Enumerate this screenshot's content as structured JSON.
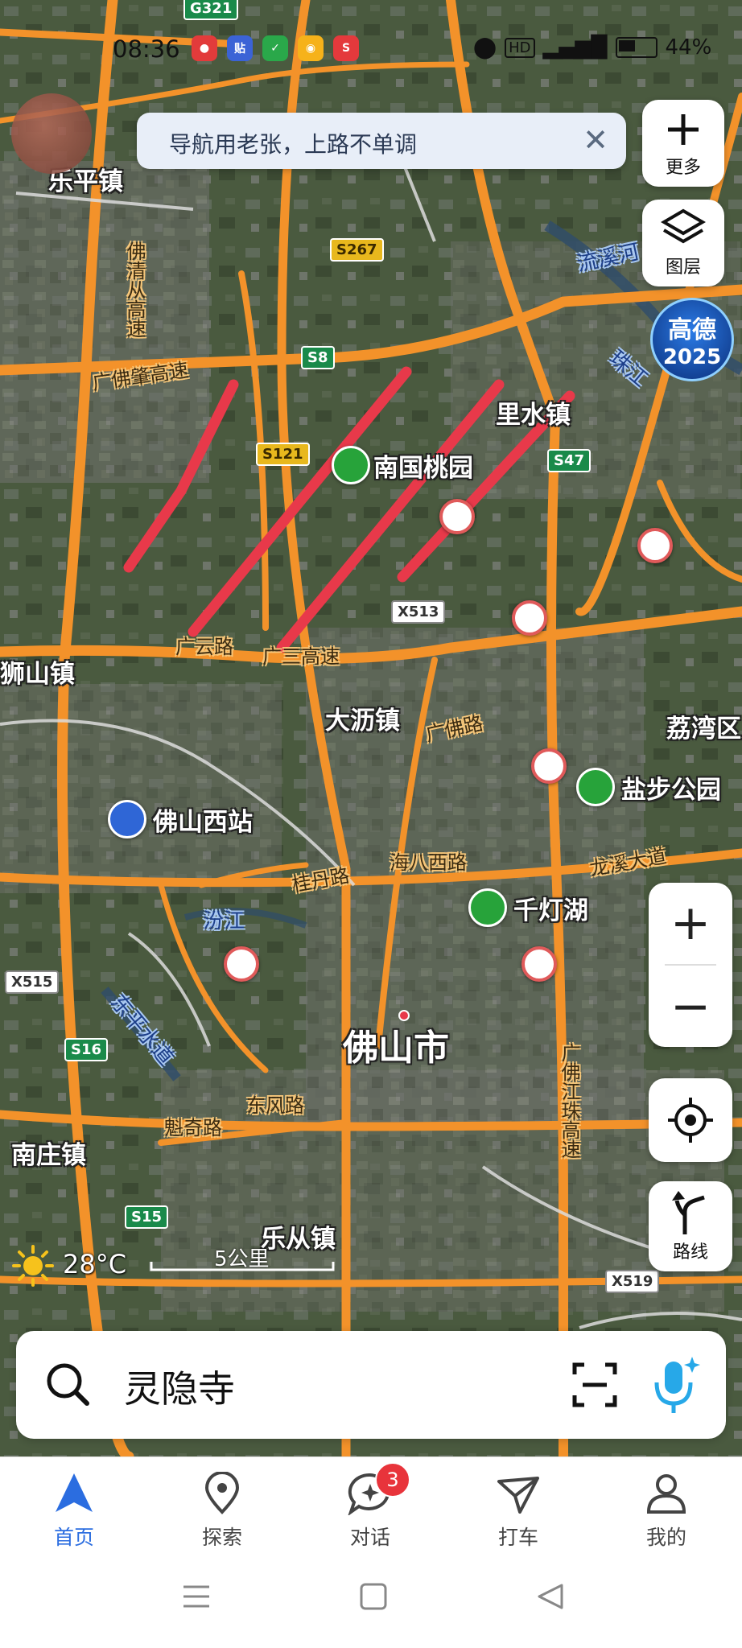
{
  "status_bar": {
    "time": "08:36",
    "battery": "44%",
    "app_icons": [
      "red-app",
      "tieba-app",
      "green-app",
      "weibo-app",
      "sina-app"
    ]
  },
  "banner": {
    "text": "导航用老张，上路不单调"
  },
  "side_buttons": {
    "more_label": "更多",
    "layers_label": "图层",
    "brand_badge_top": "高德",
    "brand_badge_year": "2025",
    "route_label": "路线"
  },
  "map": {
    "place_labels": {
      "leping": "乐平镇",
      "nanguo": "南国桃园",
      "lishui": "里水镇",
      "shishan": "狮山镇",
      "dali": "大沥镇",
      "lichwan": "荔湾区",
      "foshan_west": "佛山西站",
      "yanbu": "盐步公园",
      "qiandeng": "千灯湖",
      "foshan_city": "佛山市",
      "nanzhuang": "南庄镇",
      "lecong": "乐从镇"
    },
    "road_labels": {
      "fozhao": "广佛肇高速",
      "guangyun": "广云路",
      "guang_gaosu": "广三高速",
      "fofo_rd": "广佛路",
      "haiba": "海八西路",
      "guidan": "桂丹路",
      "longxi": "龙溪大道",
      "kuiqi": "魁奇路",
      "dongfeng": "东风路",
      "foqing": "佛清从高速",
      "fojiang": "广佛江珠高速",
      "dongping_water": "东平水道",
      "fenjiang": "汾江",
      "liuxi": "流溪河",
      "zhujiang": "珠江"
    },
    "shields": {
      "g321": "G321",
      "s267": "S267",
      "s8": "S8",
      "s121": "S121",
      "s47": "S47",
      "x513": "X513",
      "x515": "X515",
      "s16": "S16",
      "s15": "S15",
      "x519": "X519"
    },
    "scale": "5公里",
    "weather": "28°C"
  },
  "search": {
    "query": "灵隐寺"
  },
  "tabs": [
    {
      "label": "首页"
    },
    {
      "label": "探索"
    },
    {
      "label": "对话",
      "badge": "3"
    },
    {
      "label": "打车"
    },
    {
      "label": "我的"
    }
  ],
  "colors": {
    "accent": "#2b6de0",
    "road": "#f3922a",
    "annotation": "#e8394a"
  }
}
